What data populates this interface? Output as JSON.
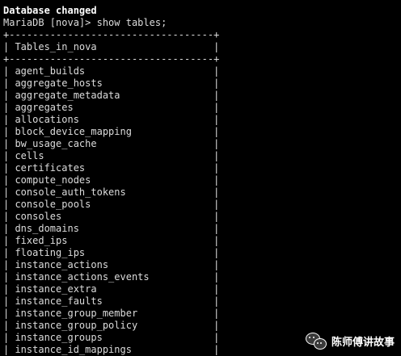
{
  "terminal": {
    "status_line": "Database changed",
    "prompt": "MariaDB [nova]> show tables;",
    "border": "+-----------------------------------+",
    "header_row": "| Tables_in_nova                    |",
    "rows": [
      "| agent_builds                      |",
      "| aggregate_hosts                   |",
      "| aggregate_metadata                |",
      "| aggregates                        |",
      "| allocations                       |",
      "| block_device_mapping              |",
      "| bw_usage_cache                    |",
      "| cells                             |",
      "| certificates                      |",
      "| compute_nodes                     |",
      "| console_auth_tokens               |",
      "| console_pools                     |",
      "| consoles                          |",
      "| dns_domains                       |",
      "| fixed_ips                         |",
      "| floating_ips                      |",
      "| instance_actions                  |",
      "| instance_actions_events           |",
      "| instance_extra                    |",
      "| instance_faults                   |",
      "| instance_group_member             |",
      "| instance_group_policy             |",
      "| instance_groups                   |",
      "| instance_id_mappings              |"
    ]
  },
  "watermark": {
    "text": "陈师傅讲故事",
    "icon": "wechat-icon"
  },
  "colors": {
    "background": "#000000",
    "text": "#dcdcdc",
    "bold_text": "#ffffff"
  }
}
